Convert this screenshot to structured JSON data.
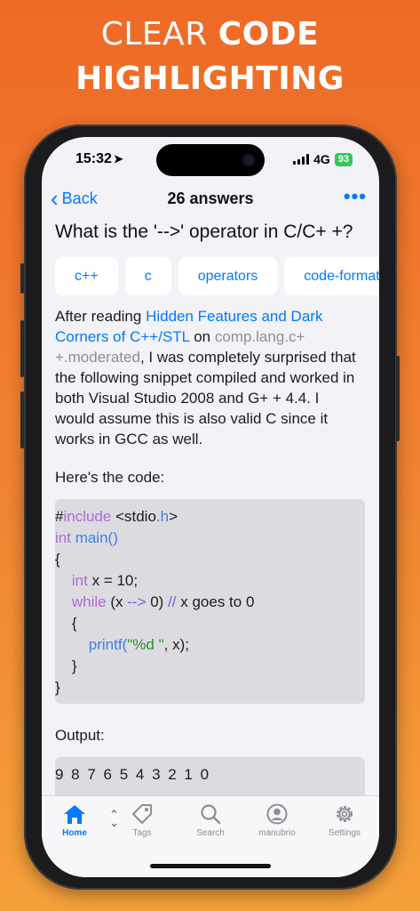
{
  "headline": {
    "part1": "CLEAR ",
    "part2": "CODE",
    "line2": "HIGHLIGHTING"
  },
  "status": {
    "time": "15:32",
    "network": "4G",
    "battery": "93"
  },
  "nav": {
    "back_label": "Back",
    "title": "26 answers",
    "more_label": "•••"
  },
  "question": {
    "title": "What is the '-->' operator in C/C+ +?",
    "tags": [
      "c++",
      "c",
      "operators",
      "code-formatting"
    ],
    "body": {
      "t1": "After reading ",
      "link1": "Hidden Features and Dark Corners of C++/STL",
      "t2": " on ",
      "muted1": "comp.lang.c+ +.moderated",
      "t3": ", I was completely surprised that the following snippet compiled and worked in both Visual Studio 2008 and G+ + 4.4. I would assume this is also valid C since it works in GCC as well."
    },
    "code_intro": "Here's the code:",
    "code": {
      "l1a": "#",
      "l1b": "include",
      "l1c": " <stdio",
      "l1d": ".h",
      "l1e": ">",
      "l2a": "int",
      "l2b": " main()",
      "l3": "{",
      "l4a": "    int",
      "l4b": " x = 10;",
      "l5a": "    while",
      "l5b": " (x ",
      "l5c": "-->",
      "l5d": " 0) ",
      "l5e": "//",
      "l5f": " x goes to 0",
      "l6": "    {",
      "l7a": "        printf(",
      "l7b": "\"%d \"",
      "l7c": ", x);",
      "l8": "    }",
      "l9": "}"
    },
    "output_label": "Output:",
    "output": "9 8 7 6 5 4 3 2 1 0"
  },
  "tabbar": {
    "items": [
      {
        "label": "Home",
        "icon": "home-icon"
      },
      {
        "label": "Tags",
        "icon": "tag-icon"
      },
      {
        "label": "Search",
        "icon": "search-icon"
      },
      {
        "label": "manubrio",
        "icon": "person-icon"
      },
      {
        "label": "Settings",
        "icon": "gear-icon"
      }
    ]
  },
  "colors": {
    "accent": "#007aff",
    "background": "#ee6a27",
    "battery": "#34c759"
  }
}
